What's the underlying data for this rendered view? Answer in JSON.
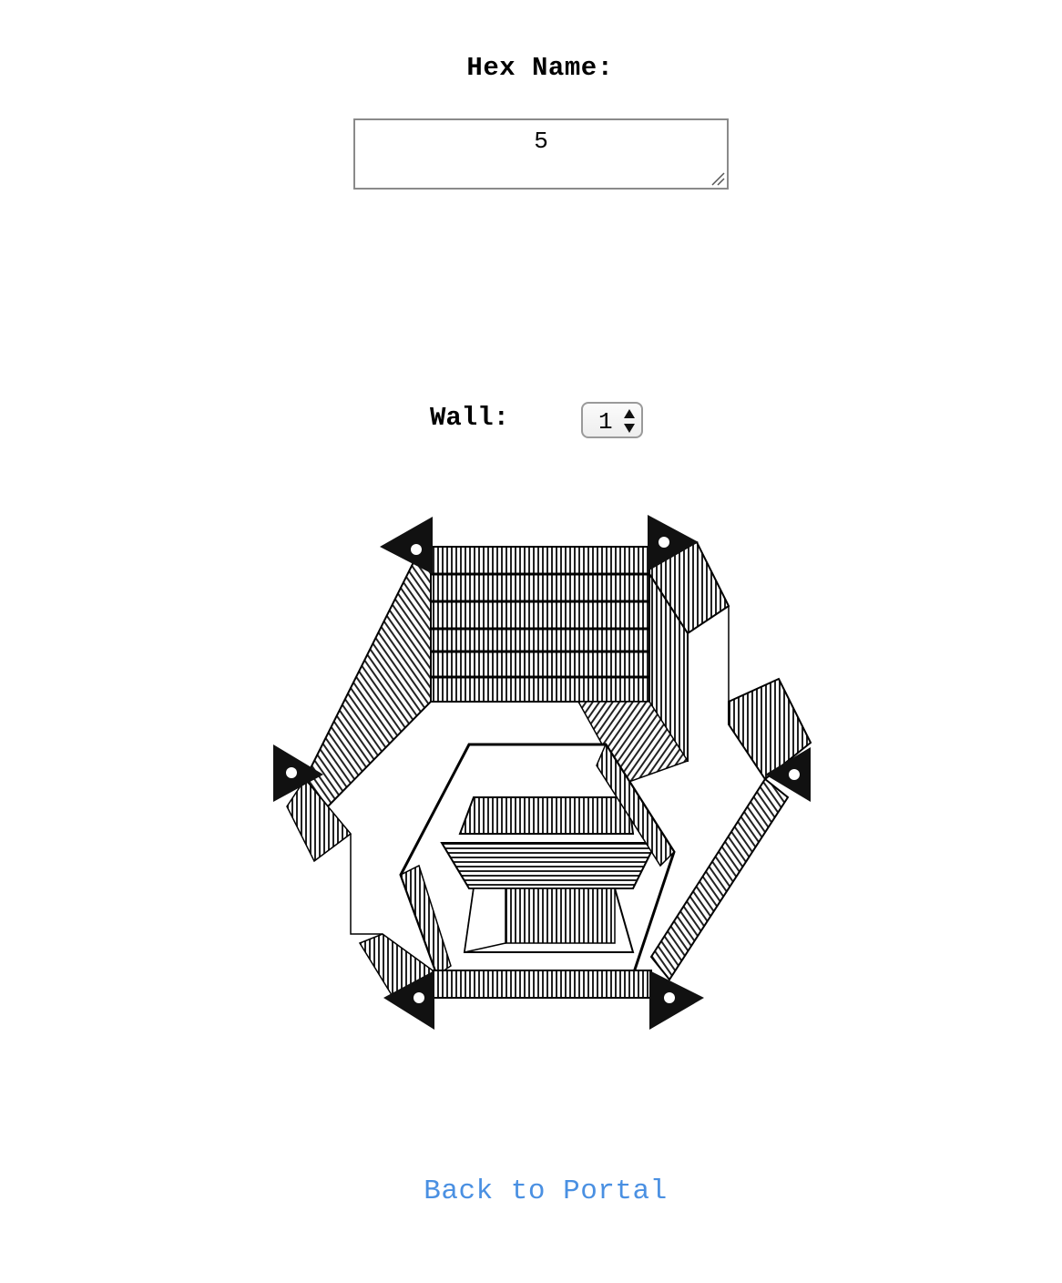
{
  "hex": {
    "label": "Hex Name:",
    "value": "5"
  },
  "wall": {
    "label": "Wall:",
    "value": "1"
  },
  "illustration": {
    "icon": "hexagonal-library-room-illustration"
  },
  "nav": {
    "back_label": "Back to Portal"
  },
  "colors": {
    "link": "#4a90e2",
    "border": "#8a8a8a"
  }
}
